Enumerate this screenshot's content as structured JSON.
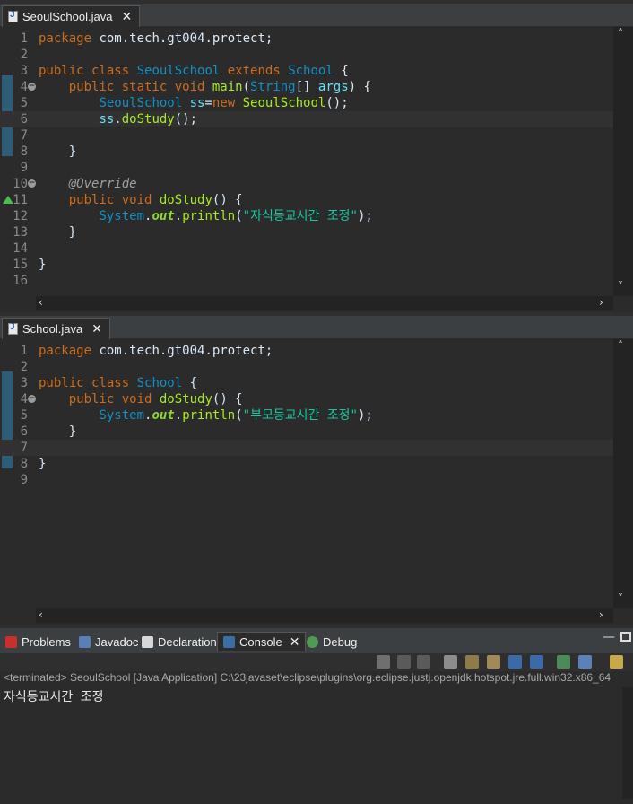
{
  "editor1": {
    "tab_label": "SeoulSchool.java",
    "lines": [
      {
        "n": "1",
        "html": "<span class=\"kw\">package</span> com.tech.gt004.protect;"
      },
      {
        "n": "2",
        "html": ""
      },
      {
        "n": "3",
        "html": "<span class=\"kw\">public class</span> <span class=\"cls\">SeoulSchool</span> <span class=\"kw\">extends</span> <span class=\"cls\">School</span> {"
      },
      {
        "n": "4",
        "html": "    <span class=\"kw\">public static void</span> <span class=\"mth\">main</span>(<span class=\"cls\">String</span>[] <span class=\"var\">args</span>) {"
      },
      {
        "n": "5",
        "html": "        <span class=\"cls\">SeoulSchool</span> <span class=\"var\">ss</span>=<span class=\"kw\">new</span> <span class=\"mth\">SeoulSchool</span>();"
      },
      {
        "n": "6",
        "html": "        <span class=\"var\">ss</span>.<span class=\"mth\">doStudy</span>();"
      },
      {
        "n": "7",
        "html": ""
      },
      {
        "n": "8",
        "html": "    }"
      },
      {
        "n": "9",
        "html": ""
      },
      {
        "n": "10",
        "html": "    <span class=\"ann\">@Override</span>"
      },
      {
        "n": "11",
        "html": "    <span class=\"kw\">public void</span> <span class=\"mth\">doStudy</span>() {"
      },
      {
        "n": "12",
        "html": "        <span class=\"sys\">System</span>.<span class=\"fld\">out</span>.<span class=\"mth\">println</span>(<span class=\"str\">\"자식등교시간 조정\"</span>);"
      },
      {
        "n": "13",
        "html": "    }"
      },
      {
        "n": "14",
        "html": ""
      },
      {
        "n": "15",
        "html": "}"
      },
      {
        "n": "16",
        "html": ""
      }
    ]
  },
  "editor2": {
    "tab_label": "School.java",
    "lines": [
      {
        "n": "1",
        "html": "<span class=\"kw\">package</span> com.tech.gt004.protect;"
      },
      {
        "n": "2",
        "html": ""
      },
      {
        "n": "3",
        "html": "<span class=\"kw\">public class</span> <span class=\"cls\">School</span> {"
      },
      {
        "n": "4",
        "html": "    <span class=\"kw\">public void</span> <span class=\"mth\">doStudy</span>() {"
      },
      {
        "n": "5",
        "html": "        <span class=\"sys\">System</span>.<span class=\"fld\">out</span>.<span class=\"mth\">println</span>(<span class=\"str\">\"부모등교시간 조정\"</span>);"
      },
      {
        "n": "6",
        "html": "    }"
      },
      {
        "n": "7",
        "html": ""
      },
      {
        "n": "8",
        "html": "}"
      },
      {
        "n": "9",
        "html": ""
      }
    ]
  },
  "console": {
    "tabs": {
      "problems": "Problems",
      "javadoc": "Javadoc",
      "declaration": "Declaration",
      "console": "Console",
      "debug": "Debug"
    },
    "status": "<terminated> SeoulSchool [Java Application] C:\\23javaset\\eclipse\\plugins\\org.eclipse.justj.openjdk.hotspot.jre.full.win32.x86_64",
    "output": "자식등교시간 조정"
  }
}
